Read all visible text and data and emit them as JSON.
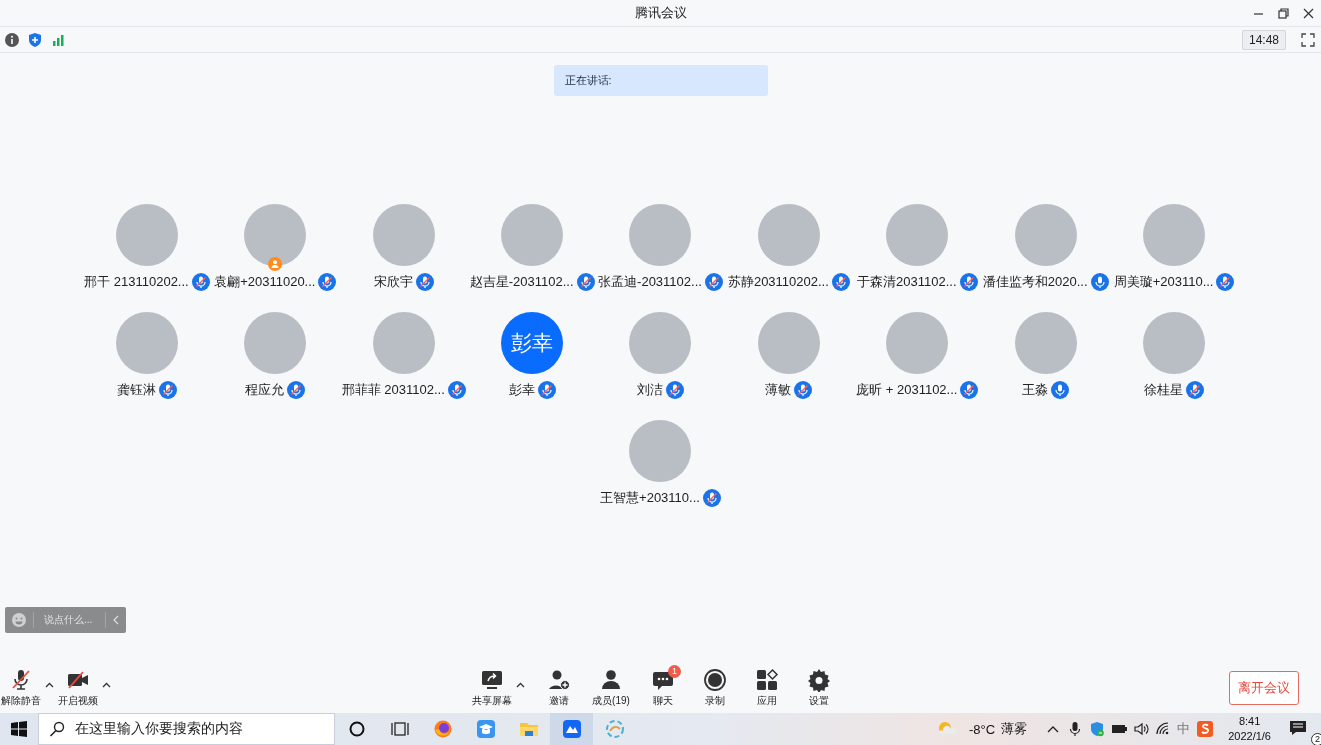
{
  "window": {
    "title": "腾讯会议"
  },
  "infobar": {
    "timer": "14:48"
  },
  "speaking": {
    "label": "正在讲话:"
  },
  "participants": [
    {
      "name": "邢干 213110202...",
      "kind": "photo",
      "muted": true,
      "host": false
    },
    {
      "name": "袁翩+20311020...",
      "kind": "photo",
      "muted": true,
      "host": true
    },
    {
      "name": "宋欣宇",
      "kind": "photo",
      "muted": true,
      "host": false
    },
    {
      "name": "赵吉星-2031102...",
      "kind": "photo",
      "muted": true,
      "host": false
    },
    {
      "name": "张孟迪-2031102...",
      "kind": "photo",
      "muted": true,
      "host": false
    },
    {
      "name": "苏静203110202...",
      "kind": "photo",
      "muted": true,
      "host": false
    },
    {
      "name": "于森清2031102...",
      "kind": "photo",
      "muted": true,
      "host": false
    },
    {
      "name": "潘佳监考和2020...",
      "kind": "photo",
      "muted": false,
      "host": false
    },
    {
      "name": "周美璇+203110...",
      "kind": "photo",
      "muted": true,
      "host": false
    },
    {
      "name": "龚钰淋",
      "kind": "photo",
      "muted": true,
      "host": false
    },
    {
      "name": "程应允",
      "kind": "photo",
      "muted": true,
      "host": false
    },
    {
      "name": "邢菲菲 2031102...",
      "kind": "photo",
      "muted": true,
      "host": false
    },
    {
      "name": "彭幸",
      "kind": "text",
      "avatar_text": "彭幸",
      "muted": true,
      "host": false
    },
    {
      "name": "刘洁",
      "kind": "photo",
      "muted": true,
      "host": false
    },
    {
      "name": "薄敏",
      "kind": "photo",
      "muted": true,
      "host": false
    },
    {
      "name": "庞昕 + 2031102...",
      "kind": "photo",
      "muted": true,
      "host": false
    },
    {
      "name": "王淼",
      "kind": "photo",
      "muted": false,
      "host": false
    },
    {
      "name": "徐桂星",
      "kind": "photo",
      "muted": true,
      "host": false
    },
    {
      "name": "王智慧+203110...",
      "kind": "photo",
      "muted": true,
      "host": false
    }
  ],
  "chat": {
    "placeholder": "说点什么..."
  },
  "toolbar": {
    "left": [
      {
        "kind": "mic",
        "label": "解除静音",
        "off": true,
        "menu": true
      },
      {
        "kind": "camera",
        "label": "开启视频",
        "off": true,
        "menu": true
      }
    ],
    "center": [
      {
        "kind": "share",
        "label": "共享屏幕",
        "menu": true
      },
      {
        "kind": "invite",
        "label": "邀请",
        "menu": false
      },
      {
        "kind": "members",
        "label": "成员(19)",
        "menu": false
      },
      {
        "kind": "chat",
        "label": "聊天",
        "badge": "1",
        "menu": false
      },
      {
        "kind": "record",
        "label": "录制",
        "menu": false
      },
      {
        "kind": "apps",
        "label": "应用",
        "menu": false
      },
      {
        "kind": "settings",
        "label": "设置",
        "menu": false
      }
    ],
    "leave": "离开会议"
  },
  "taskbar": {
    "search_placeholder": "在这里输入你要搜索的内容",
    "temperature": "-8°C",
    "condition": "薄雾",
    "ime": "中",
    "time": "8:41",
    "date": "2022/1/6",
    "notifications": "2"
  }
}
